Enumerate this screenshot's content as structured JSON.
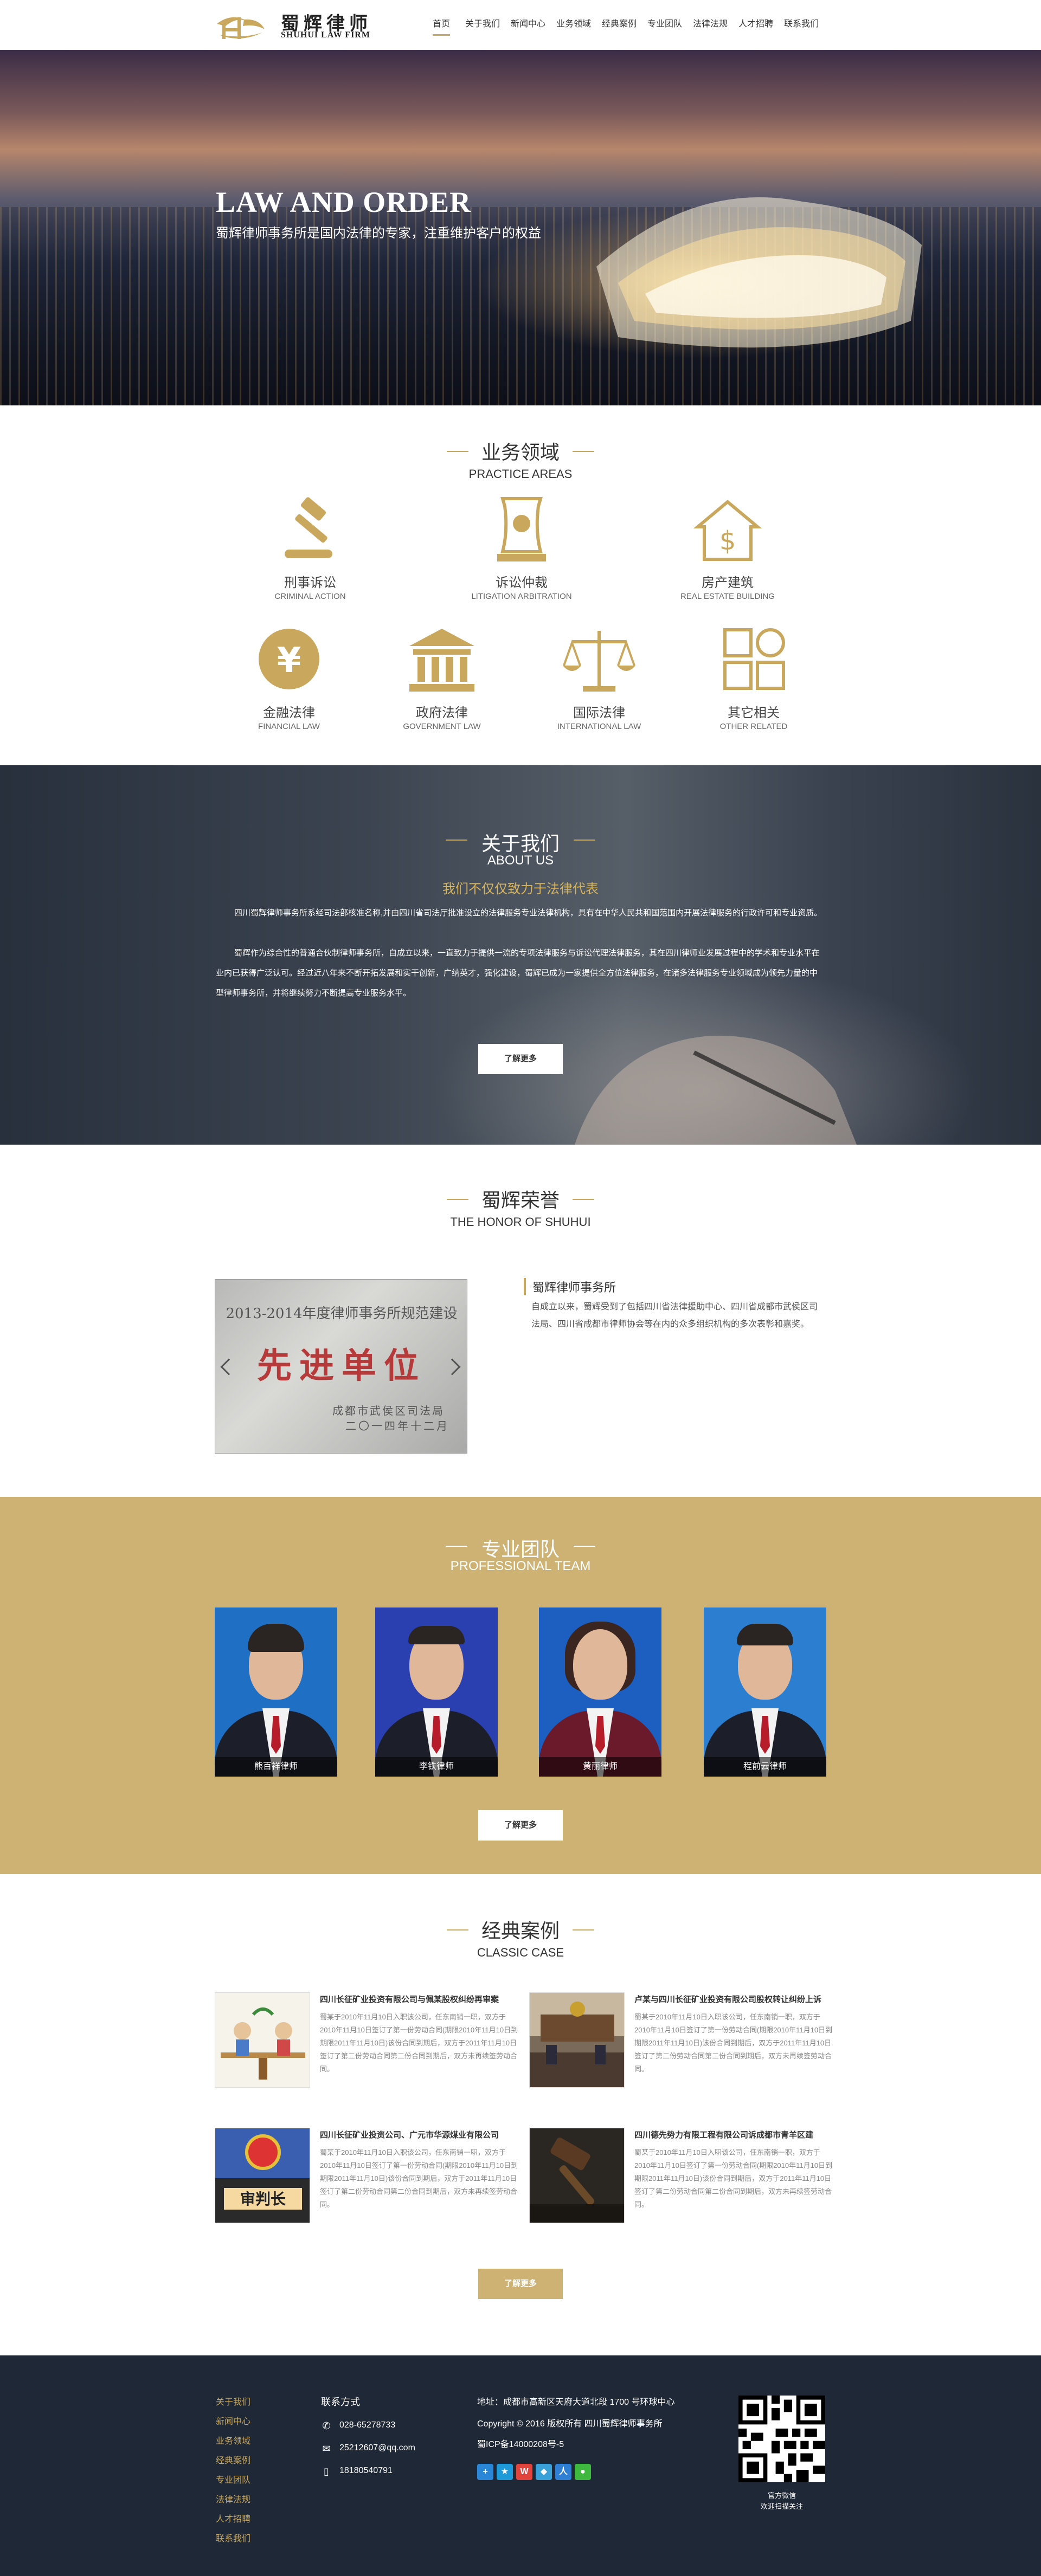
{
  "header": {
    "logo_cn": "蜀辉律师",
    "logo_en": "SHUHUI LAW FIRM",
    "nav": [
      "首页",
      "关于我们",
      "新闻中心",
      "业务领域",
      "经典案例",
      "专业团队",
      "法律法规",
      "人才招聘",
      "联系我们"
    ]
  },
  "banner": {
    "title": "LAW AND ORDER",
    "subtitle": "蜀辉律师事务所是国内法律的专家，注重维护客户的权益"
  },
  "practice": {
    "title_cn": "业务领域",
    "title_en": "PRACTICE AREAS",
    "items": [
      {
        "cn": "刑事诉讼",
        "en": "CRIMINAL ACTION",
        "icon": "gavel-icon"
      },
      {
        "cn": "诉讼仲裁",
        "en": "LITIGATION ARBITRATION",
        "icon": "award-icon"
      },
      {
        "cn": "房产建筑",
        "en": "REAL ESTATE BUILDING",
        "icon": "house-dollar-icon"
      },
      {
        "cn": "金融法律",
        "en": "FINANCIAL LAW",
        "icon": "yen-icon"
      },
      {
        "cn": "政府法律",
        "en": "GOVERNMENT LAW",
        "icon": "government-building-icon"
      },
      {
        "cn": "国际法律",
        "en": "INTERNATIONAL LAW",
        "icon": "scales-icon"
      },
      {
        "cn": "其它相关",
        "en": "OTHER RELATED",
        "icon": "grid-icon"
      }
    ]
  },
  "about": {
    "title_cn": "关于我们",
    "title_en": "ABOUT US",
    "slogan": "我们不仅仅致力于法律代表",
    "p1": "四川蜀辉律师事务所系经司法部核准名称,并由四川省司法厅批准设立的法律服务专业法律机构，具有在中华人民共和国范围内开展法律服务的行政许可和专业资质。",
    "p2": "蜀辉作为综合性的普通合伙制律师事务所，自成立以来，一直致力于提供一流的专项法律服务与诉讼代理法律服务，其在四川律师业发展过程中的学术和专业水平在业内已获得广泛认可。经过近八年来不断开拓发展和实干创新，广纳英才，强化建设，蜀辉已成为一家提供全方位法律服务，在诸多法律服务专业领域成为领先力量的中型律师事务所，并将继续努力不断提高专业服务水平。",
    "button": "了解更多"
  },
  "honor": {
    "title_cn": "蜀辉荣誉",
    "title_en": "THE HONOR OF SHUHUI",
    "plaque_line1": "2013-2014年度律师事务所规范建设",
    "plaque_line2": "先进单位",
    "plaque_line3": "成都市武侯区司法局",
    "plaque_line4": "二〇一四年十二月",
    "name": "蜀辉律师事务所",
    "desc": "自成立以来，蜀辉受到了包括四川省法律援助中心、四川省成都市武侯区司法局、四川省成都市律师协会等在内的众多组织机构的多次表彰和嘉奖。"
  },
  "team": {
    "title_cn": "专业团队",
    "title_en": "PROFESSIONAL TEAM",
    "members": [
      {
        "name": "熊百祥律师",
        "bg": "#1f6fc4"
      },
      {
        "name": "李铁律师",
        "bg": "#2a3fb0"
      },
      {
        "name": "黄丽律师",
        "bg": "#1d5fc0"
      },
      {
        "name": "程前云律师",
        "bg": "#2b7ed0"
      }
    ],
    "button": "了解更多"
  },
  "cases": {
    "title_cn": "经典案例",
    "title_en": "CLASSIC CASE",
    "items": [
      {
        "title": "四川长征矿业投资有限公司与佩某股权纠纷再审案",
        "text": "蜀某于2010年11月10日入职该公司，任东南销一职，双方于2010年11月10日签订了第一份劳动合同(期限2010年11月10日到期限2011年11月10日)该份合同到期后，双方于2011年11月10日签订了第二份劳动合同第二份合同到期后，双方未再续签劳动合同。"
      },
      {
        "title": "卢某与四川长征矿业投资有限公司股权转让纠纷上诉",
        "text": "蜀某于2010年11月10日入职该公司，任东南销一职，双方于2010年11月10日签订了第一份劳动合同(期限2010年11月10日到期限2011年11月10日)该份合同到期后，双方于2011年11月10日签订了第二份劳动合同第二份合同到期后，双方未再续签劳动合同。"
      },
      {
        "title": "四川长征矿业投资公司、广元市华源煤业有限公司",
        "text": "蜀某于2010年11月10日入职该公司，任东南销一职，双方于2010年11月10日签订了第一份劳动合同(期限2010年11月10日到期限2011年11月10日)该份合同到期后，双方于2011年11月10日签订了第二份劳动合同第二份合同到期后，双方未再续签劳动合同。"
      },
      {
        "title": "四川德先势力有限工程有限公司诉成都市青羊区建",
        "text": "蜀某于2010年11月10日入职该公司，任东南销一职，双方于2010年11月10日签订了第一份劳动合同(期限2010年11月10日到期限2011年11月10日)该份合同到期后，双方于2011年11月10日签订了第二份劳动合同第二份合同到期后，双方未再续签劳动合同。"
      }
    ],
    "image_labels": [
      "审判长"
    ],
    "button": "了解更多"
  },
  "footer": {
    "links": [
      "关于我们",
      "新闻中心",
      "业务领域",
      "经典案例",
      "专业团队",
      "法律法规",
      "人才招聘",
      "联系我们"
    ],
    "contact_title": "联系方式",
    "phone": "028-65278733",
    "email": "25212607@qq.com",
    "mobile": "18180540791",
    "address": "地址：成都市高新区天府大道北段 1700 号环球中心",
    "copyright": "Copyright © 2016 版权所有 四川蜀辉律师事务所",
    "icp": "蜀ICP备14000208号-5",
    "qr_line1": "官方微信",
    "qr_line2": "欢迎扫描关注"
  },
  "colors": {
    "accent": "#c9a85e",
    "team_bg": "#cdb273",
    "footer_bg": "#1f2836"
  }
}
